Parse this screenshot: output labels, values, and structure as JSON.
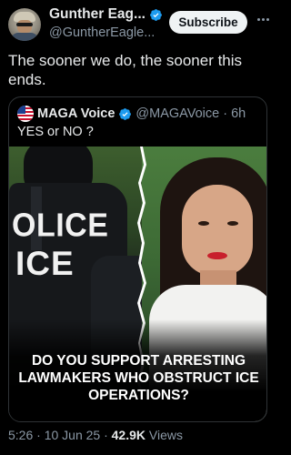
{
  "author": {
    "display_name": "Gunther Eag...",
    "handle": "@GuntherEagle...",
    "verified": true,
    "avatar_icon": "user-avatar"
  },
  "actions": {
    "subscribe_label": "Subscribe",
    "more_icon": "more-dots-icon"
  },
  "tweet": {
    "text": "The sooner we do,  the sooner this ends."
  },
  "quoted": {
    "display_name": "MAGA Voice",
    "handle_time": "@MAGAVoice · 6h",
    "verified": true,
    "text": "YES or NO ?",
    "media": {
      "left_text_line1": "OLICE",
      "left_text_line2": "ICE",
      "headline": "DO YOU SUPPORT ARRESTING LAWMAKERS WHO OBSTRUCT ICE OPERATIONS?"
    }
  },
  "meta": {
    "time_date": "5:26 · 10 Jun 25 · ",
    "views_count": "42.9K",
    "views_label": " Views"
  },
  "colors": {
    "background": "#000000",
    "text_primary": "#e7e9ea",
    "text_secondary": "#8b98a5",
    "verified_blue": "#1d9bf0",
    "border": "#2f3336"
  }
}
